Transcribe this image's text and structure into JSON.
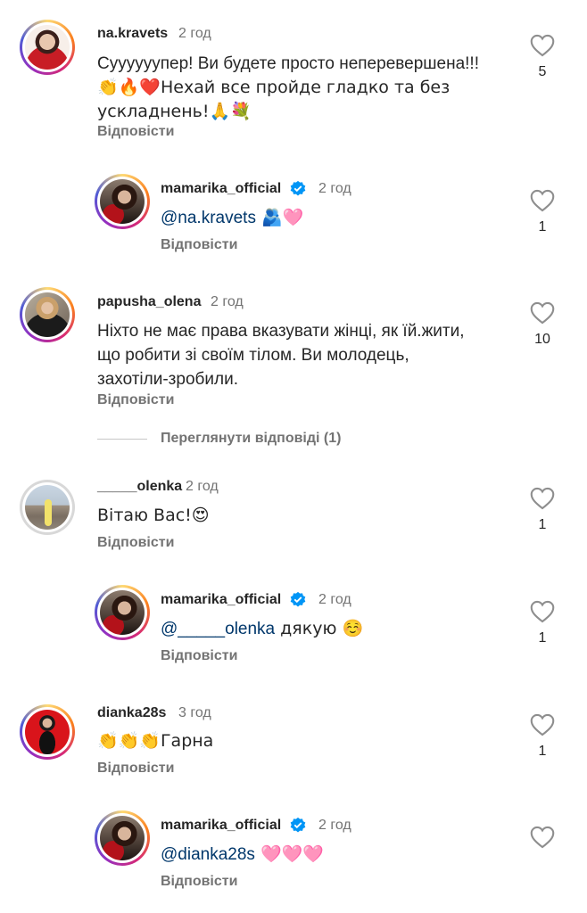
{
  "reply_label": "Відповісти",
  "comments": [
    {
      "username": "na.kravets",
      "time": "2 год",
      "text_line1": "Суууууупер! Ви будете просто неперевершена!!!",
      "text_line2": "👏🔥❤️Нехай все пройде гладко та без",
      "text_line3": "ускладнень!🙏💐",
      "likes": "5"
    },
    {
      "username": "mamarika_official",
      "time": "2 год",
      "mention": "@na.kravets",
      "text_rest": " 🫂🩷",
      "likes": "1"
    },
    {
      "username": "papusha_olena",
      "time": "2 год",
      "text_line1": "Ніхто не має права вказувати жінці, як їй.жити,",
      "text_line2": "що робити зі своїм тілом. Ви молодець,",
      "text_line3": "захотіли-зробили.",
      "likes": "10",
      "view_replies": "Переглянути відповіді (1)"
    },
    {
      "username": "_____olenka",
      "time": "2 год",
      "text": "Вітаю Вас!😍",
      "likes": "1"
    },
    {
      "username": "mamarika_official",
      "time": "2 год",
      "mention": "@_____olenka",
      "text_rest": " дякую ☺️",
      "likes": "1"
    },
    {
      "username": "dianka28s",
      "time": "3 год",
      "text": "👏👏👏Гарна",
      "likes": "1"
    },
    {
      "username": "mamarika_official",
      "time": "2 год",
      "mention": "@dianka28s",
      "text_rest": " 🩷🩷🩷",
      "likes": ""
    }
  ],
  "colors": {
    "text": "#262626",
    "secondary": "#737373",
    "mention": "#00376b",
    "verified": "#0095f6"
  }
}
